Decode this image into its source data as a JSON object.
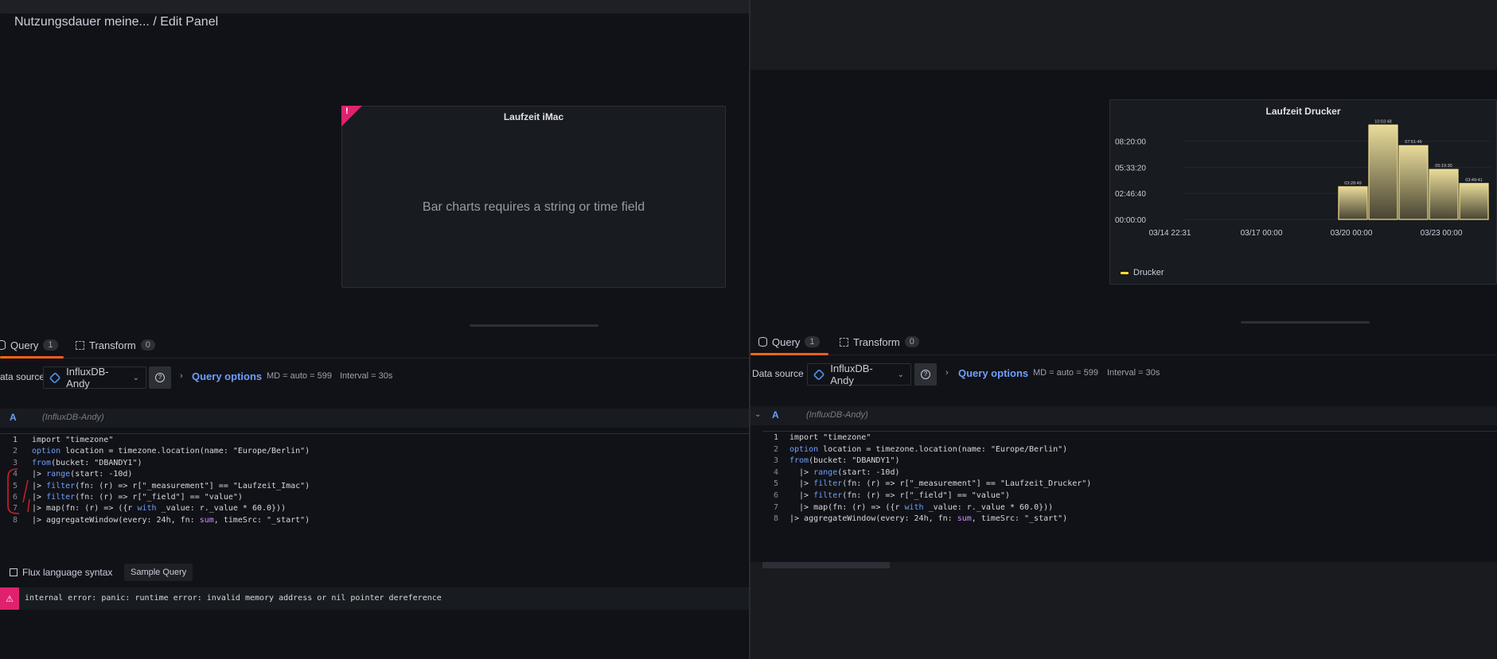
{
  "left": {
    "breadcrumb": "Nutzungsdauer meine... / Edit Panel",
    "panel": {
      "title": "Laufzeit iMac",
      "error_mark": "!",
      "message": "Bar charts requires a string or time field"
    },
    "tabs": {
      "query_label": "Query",
      "query_count": "1",
      "transform_label": "Transform",
      "transform_count": "0"
    },
    "datasource": {
      "label": "ata source",
      "selected": "InfluxDB-Andy",
      "query_options": "Query options",
      "md": "MD = auto = 599",
      "interval": "Interval = 30s"
    },
    "query": {
      "letter": "A",
      "ds": "(InfluxDB-Andy)"
    },
    "code_lines": [
      {
        "n": "1",
        "text": "import \"timezone\""
      },
      {
        "n": "2",
        "text": "option location = timezone.location(name: \"Europe/Berlin\")"
      },
      {
        "n": "3",
        "text": "from(bucket: \"DBANDY1\")"
      },
      {
        "n": "4",
        "text": "|> range(start: -10d)"
      },
      {
        "n": "5",
        "text": "|> filter(fn: (r) => r[\"_measurement\"] == \"Laufzeit_Imac\")"
      },
      {
        "n": "6",
        "text": "|> filter(fn: (r) => r[\"_field\"] == \"value\")"
      },
      {
        "n": "7",
        "text": "|> map(fn: (r) => ({r with _value: r._value * 60.0}))"
      },
      {
        "n": "8",
        "text": "|> aggregateWindow(every: 24h, fn: sum, timeSrc: \"_start\")"
      }
    ],
    "footer": {
      "flux_link": "Flux language syntax",
      "sample_query": "Sample Query"
    },
    "error_text": "internal error: panic: runtime error: invalid memory address or nil pointer dereference"
  },
  "right": {
    "panel": {
      "title": "Laufzeit Drucker",
      "legend": "Drucker"
    },
    "tabs": {
      "query_label": "Query",
      "query_count": "1",
      "transform_label": "Transform",
      "transform_count": "0"
    },
    "datasource": {
      "label": "Data source",
      "selected": "InfluxDB-Andy",
      "query_options": "Query options",
      "md": "MD = auto = 599",
      "interval": "Interval = 30s"
    },
    "query": {
      "letter": "A",
      "ds": "(InfluxDB-Andy)"
    },
    "code_lines": [
      {
        "n": "1",
        "text": "import \"timezone\""
      },
      {
        "n": "2",
        "text": "option location = timezone.location(name: \"Europe/Berlin\")"
      },
      {
        "n": "3",
        "text": "from(bucket: \"DBANDY1\")"
      },
      {
        "n": "4",
        "text": "  |> range(start: -10d)"
      },
      {
        "n": "5",
        "text": "  |> filter(fn: (r) => r[\"_measurement\"] == \"Laufzeit_Drucker\")"
      },
      {
        "n": "6",
        "text": "  |> filter(fn: (r) => r[\"_field\"] == \"value\")"
      },
      {
        "n": "7",
        "text": "  |> map(fn: (r) => ({r with _value: r._value * 60.0}))"
      },
      {
        "n": "8",
        "text": "|> aggregateWindow(every: 24h, fn: sum, timeSrc: \"_start\")"
      }
    ]
  },
  "colors": {
    "accent_link": "#6e9fff",
    "error": "#e0226e",
    "series": "#fade2a"
  },
  "chart_data": {
    "type": "bar",
    "title": "Laufzeit Drucker",
    "y_tick_labels": [
      "08:20:00",
      "05:33:20",
      "02:46:40",
      "00:00:00"
    ],
    "x_tick_labels": [
      "03/14 22:31",
      "03/17 00:00",
      "03/20 00:00",
      "03/23 00:00"
    ],
    "ylim_seconds": [
      0,
      36000
    ],
    "series": [
      {
        "name": "Drucker",
        "bars": [
          {
            "label": "03:28:49",
            "seconds": 12529
          },
          {
            "label": "10:03:48",
            "seconds": 36228
          },
          {
            "label": "07:51:46",
            "seconds": 28306
          },
          {
            "label": "05:19:30",
            "seconds": 19170
          },
          {
            "label": "03:49:41",
            "seconds": 13781
          }
        ]
      }
    ],
    "legend": "bottom-left",
    "grid": true
  }
}
